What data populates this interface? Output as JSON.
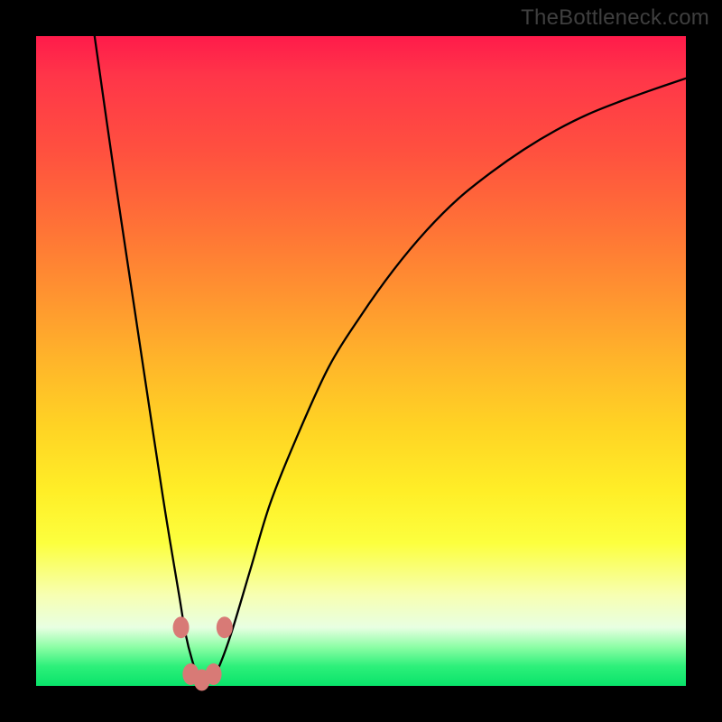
{
  "watermark": "TheBottleneck.com",
  "chart_data": {
    "type": "line",
    "title": "",
    "xlabel": "",
    "ylabel": "",
    "xlim": [
      0,
      100
    ],
    "ylim": [
      0,
      100
    ],
    "grid": false,
    "series": [
      {
        "name": "bottleneck-curve",
        "x": [
          9,
          12,
          15,
          18,
          20,
          22,
          23,
          24,
          25,
          26,
          27,
          28,
          30,
          33,
          36,
          40,
          45,
          50,
          55,
          60,
          65,
          70,
          75,
          80,
          85,
          90,
          95,
          100
        ],
        "y": [
          100,
          79,
          59,
          39,
          26,
          14,
          8,
          4,
          1.3,
          0.8,
          1.2,
          2.6,
          8,
          18,
          28,
          38,
          49,
          57,
          64,
          70,
          75,
          79,
          82.5,
          85.5,
          88,
          90,
          91.8,
          93.5
        ],
        "color": "#000000"
      }
    ],
    "markers": {
      "name": "flat-region-dots",
      "color": "#d87a76",
      "points": [
        {
          "x": 22.3,
          "y": 9.0
        },
        {
          "x": 23.8,
          "y": 1.8
        },
        {
          "x": 25.5,
          "y": 0.9
        },
        {
          "x": 27.3,
          "y": 1.8
        },
        {
          "x": 29.0,
          "y": 9.0
        }
      ]
    }
  }
}
